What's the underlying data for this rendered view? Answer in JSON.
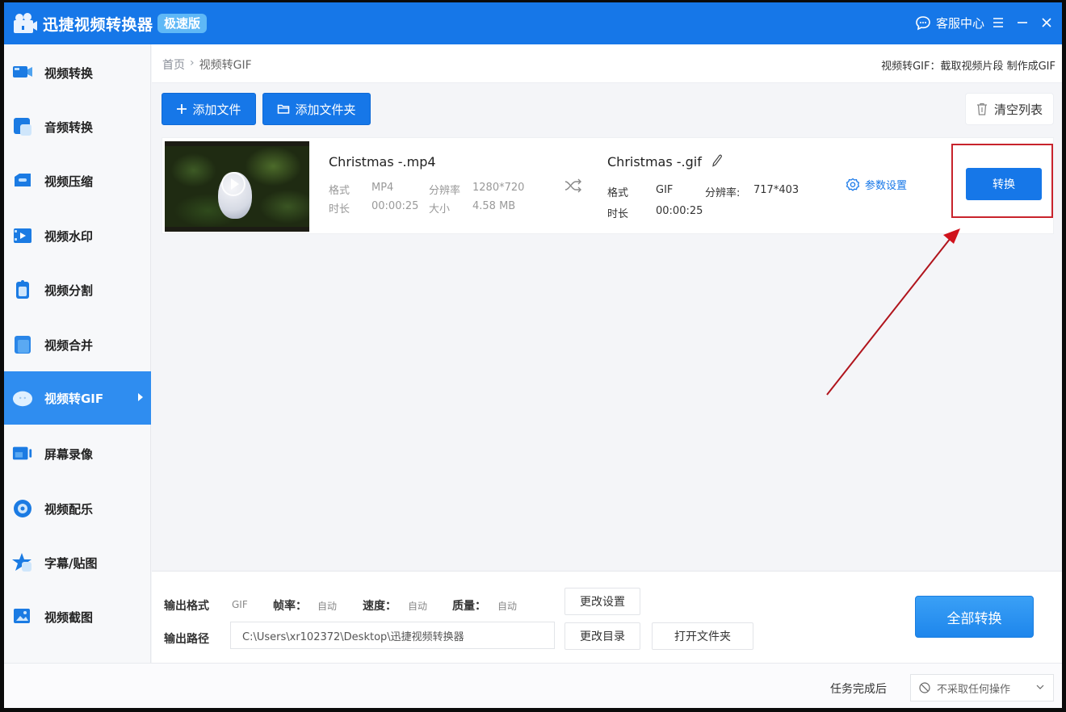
{
  "app": {
    "title": "迅捷视频转换器",
    "edition": "极速版",
    "service_label": "客服中心",
    "colors": {
      "primary": "#1677e8",
      "highlight_box": "#c8232c",
      "annotation_arrow": "#c8232c"
    }
  },
  "sidebar": {
    "items": [
      {
        "label": "视频转换",
        "icon": "video-convert-icon",
        "active": false
      },
      {
        "label": "音频转换",
        "icon": "audio-convert-icon",
        "active": false
      },
      {
        "label": "视频压缩",
        "icon": "video-compress-icon",
        "active": false
      },
      {
        "label": "视频水印",
        "icon": "video-watermark-icon",
        "active": false
      },
      {
        "label": "视频分割",
        "icon": "video-split-icon",
        "active": false
      },
      {
        "label": "视频合并",
        "icon": "video-merge-icon",
        "active": false
      },
      {
        "label": "视频转GIF",
        "icon": "video-to-gif-icon",
        "active": true
      },
      {
        "label": "屏幕录像",
        "icon": "screen-record-icon",
        "active": false
      },
      {
        "label": "视频配乐",
        "icon": "video-music-icon",
        "active": false
      },
      {
        "label": "字幕/贴图",
        "icon": "subtitle-sticker-icon",
        "active": false
      },
      {
        "label": "视频截图",
        "icon": "video-screenshot-icon",
        "active": false
      }
    ]
  },
  "breadcrumb": {
    "home": "首页",
    "separator": "›",
    "current": "视频转GIF"
  },
  "hint": "视频转GIF：截取视频片段 制作成GIF",
  "toolbar": {
    "add_file": "添加文件",
    "add_folder": "添加文件夹",
    "clear_list": "清空列表"
  },
  "file": {
    "source": {
      "name": "Christmas -.mp4",
      "format_label": "格式",
      "format": "MP4",
      "resolution_label": "分辨率",
      "resolution": "1280*720",
      "duration_label": "时长",
      "duration": "00:00:25",
      "size_label": "大小",
      "size": "4.58 MB"
    },
    "output": {
      "name": "Christmas -.gif",
      "format_label": "格式",
      "format": "GIF",
      "resolution_label": "分辨率:",
      "resolution": "717*403",
      "duration_label": "时长",
      "duration": "00:00:25"
    },
    "param_settings": "参数设置",
    "convert": "转换"
  },
  "output_panel": {
    "format_label": "输出格式",
    "format": "GIF",
    "framerate_label": "帧率：",
    "framerate": "自动",
    "speed_label": "速度：",
    "speed": "自动",
    "quality_label": "质量：",
    "quality": "自动",
    "change_settings": "更改设置",
    "path_label": "输出路径",
    "path": "C:\\Users\\xr102372\\Desktop\\迅捷视频转换器",
    "change_dir": "更改目录",
    "open_folder": "打开文件夹",
    "convert_all": "全部转换"
  },
  "statusbar": {
    "after_label": "任务完成后",
    "after_value": "不采取任何操作"
  }
}
